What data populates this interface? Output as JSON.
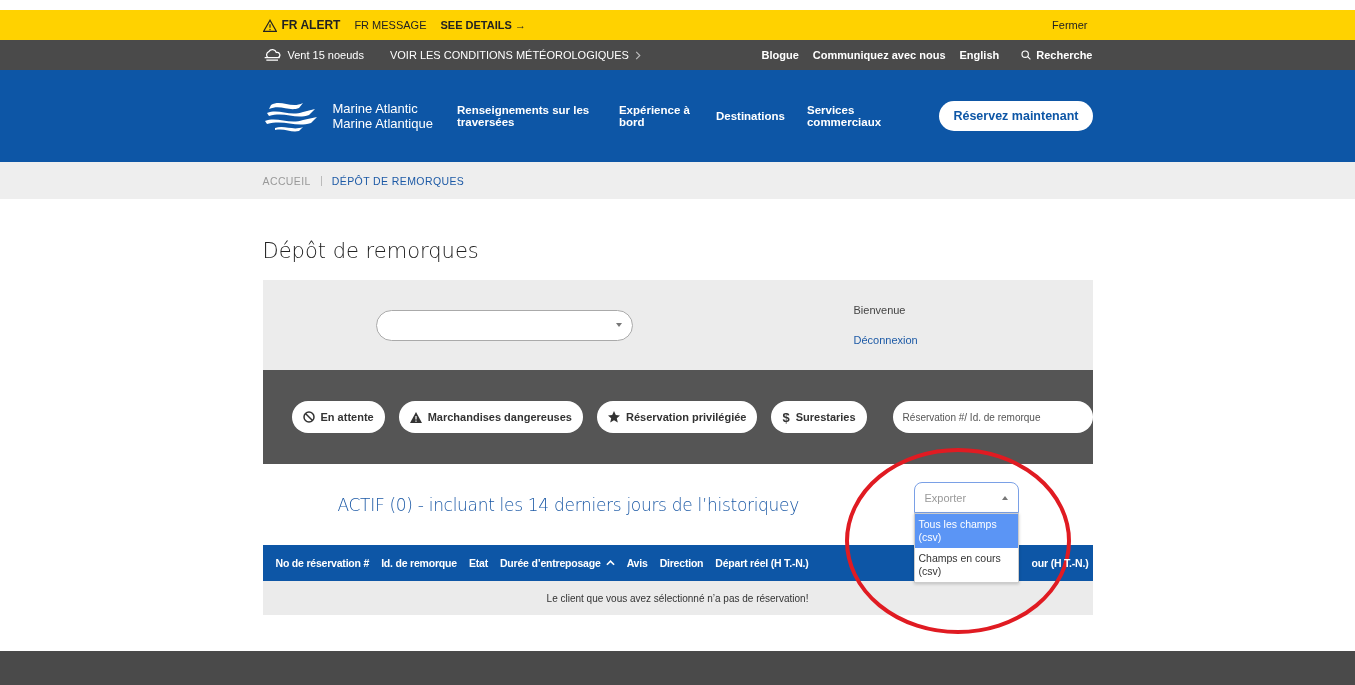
{
  "alert": {
    "label": "FR ALERT",
    "message": "FR MESSAGE",
    "link": "SEE DETAILS →",
    "close": "Fermer"
  },
  "utility_bar": {
    "weather": "Vent 15 noeuds",
    "conditions_link": "VOIR LES CONDITIONS MÉTÉOROLOGIQUES",
    "links": [
      "Blogue",
      "Communiquez avec nous",
      "English"
    ],
    "search": "Recherche"
  },
  "nav": {
    "logo_lines": [
      "Marine Atlantic",
      "Marine Atlantique"
    ],
    "items": [
      "Renseignements sur les traversées",
      "Expérience à bord",
      "Destinations",
      "Services commerciaux"
    ],
    "cta": "Réservez maintenant"
  },
  "breadcrumb": [
    {
      "label": "ACCUEIL",
      "selected": false
    },
    {
      "label": "DÉPÔT DE REMORQUES",
      "selected": true
    }
  ],
  "page_title": "Dépôt de remorques",
  "account": {
    "greeting": "Bienvenue",
    "logout": "Déconnexion"
  },
  "filters": [
    {
      "kind": "ban",
      "label": "En attente"
    },
    {
      "kind": "warning",
      "label": "Marchandises dangereuses"
    },
    {
      "kind": "star",
      "label": "Réservation privilégiée"
    },
    {
      "kind": "symbol",
      "symbol": "$",
      "label": "Surestaries"
    }
  ],
  "search": {
    "placeholder": "Réservation #/ Id. de remorque"
  },
  "section_title": "ACTIF (0) - incluant les 14 derniers jours de l’historiquey",
  "export": {
    "placeholder": "Exporter",
    "expanded": true,
    "options": [
      {
        "label": "Tous les champs (csv)",
        "selected": true
      },
      {
        "label": "Champs en cours (csv)",
        "selected": false
      }
    ]
  },
  "table": {
    "columns": [
      {
        "label": "No de réservation #",
        "sorted": false
      },
      {
        "label": "Id. de remorque",
        "sorted": false
      },
      {
        "label": "Etat",
        "sorted": false
      },
      {
        "label": "Durée d’entreposage",
        "sorted": true
      },
      {
        "label": "Avis",
        "sorted": false
      },
      {
        "label": "Direction",
        "sorted": false
      },
      {
        "label": "Départ réel (H T.-N.)",
        "sorted": false
      },
      {
        "label": "our (H T.-N.)",
        "sorted": false
      }
    ],
    "empty_message": "Le client que vous avez sélectionné n’a pas de réservation!"
  }
}
